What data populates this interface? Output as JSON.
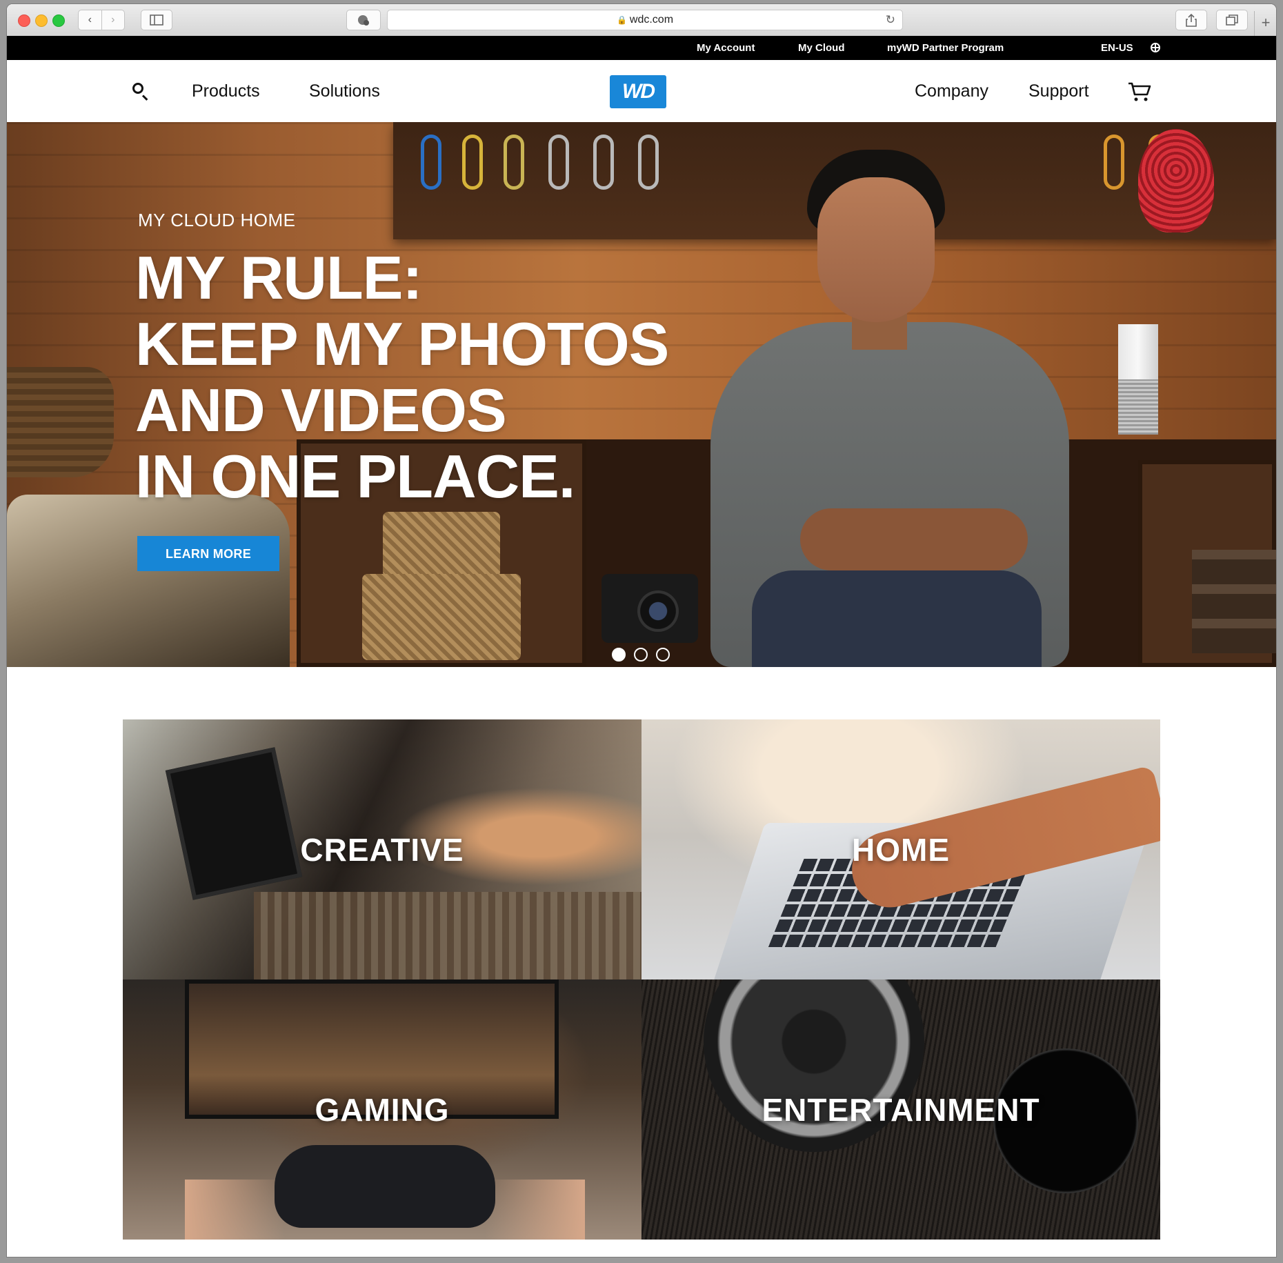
{
  "browser": {
    "url": "wdc.com",
    "icons": {
      "back": "chevron-left-icon",
      "forward": "chevron-right-icon",
      "sidebar": "sidebar-icon",
      "reader": "extension-icon",
      "lock": "lock-icon",
      "reload": "reload-icon",
      "share": "share-icon",
      "tabs": "tabs-icon",
      "new_tab": "plus-icon"
    }
  },
  "utility_nav": {
    "my_account": "My Account",
    "my_cloud": "My Cloud",
    "partner": "myWD Partner Program",
    "locale": "EN-US"
  },
  "main_nav": {
    "products": "Products",
    "solutions": "Solutions",
    "logo": "WD",
    "company": "Company",
    "support": "Support"
  },
  "hero": {
    "eyebrow": "MY CLOUD HOME",
    "headline": [
      "MY RULE:",
      "KEEP MY PHOTOS",
      "AND VIDEOS",
      "IN ONE PLACE."
    ],
    "cta": "LEARN MORE",
    "slides": {
      "count": 3,
      "active": 1
    }
  },
  "tiles": [
    "CREATIVE",
    "HOME",
    "GAMING",
    "ENTERTAINMENT"
  ],
  "colors": {
    "brand_blue": "#1786d6",
    "utility_bar": "#000000",
    "text": "#111111"
  }
}
